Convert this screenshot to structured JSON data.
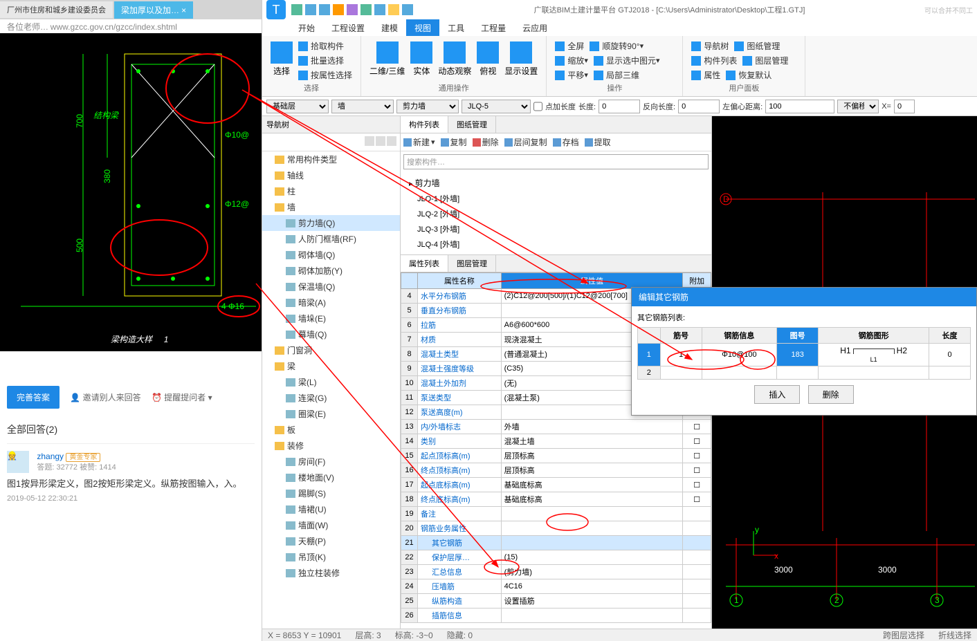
{
  "browser": {
    "tab1": "厂州市住房和城乡建设委员会",
    "tab2": "梁加厚以及加…",
    "tab2_close": "×",
    "url_prefix": "各位老师…",
    "url": "www.gzcc.gov.cn/gzcc/index.shtml"
  },
  "qa": {
    "improve_btn": "完善答案",
    "invite": "邀请别人来回答",
    "remind": "提醒提问者",
    "all_answers": "全部回答(2)",
    "user": "zhangy",
    "badge": "黄金专家",
    "stats": "答题: 32772   被赞: 1414",
    "text": "图1按异形梁定义，图2按矩形梁定义。纵筋按图输入，入。",
    "time": "2019-05-12 22:30:21"
  },
  "app": {
    "icon": "T",
    "title": "广联达BIM土建计量平台 GTJ2018 - [C:\\Users\\Administrator\\Desktop\\工程1.GTJ]",
    "merge_hint": "可以合并不同工",
    "menus": [
      "开始",
      "工程设置",
      "建模",
      "视图",
      "工具",
      "工程量",
      "云应用"
    ],
    "active_menu": 3
  },
  "ribbon": {
    "g1": {
      "label": "选择",
      "sel": "选择",
      "pick": "拾取构件",
      "batch": "批量选择",
      "filter": "按属性选择"
    },
    "g2": {
      "label": "通用操作",
      "v2d3d": "二维/三维",
      "solid": "实体",
      "dyn": "动态观察",
      "top": "俯视",
      "disp": "显示设置"
    },
    "g3": {
      "label": "操作",
      "full": "全屏",
      "rot": "顺旋转90°",
      "zoom": "缩放",
      "pan": "平移",
      "selshow": "显示选中图元",
      "local3d": "局部三维"
    },
    "g4": {
      "label": "用户面板",
      "nav": "导航树",
      "comp": "构件列表",
      "prop": "属性",
      "dwg": "图纸管理",
      "layer": "图层管理",
      "restore": "恢复默认"
    }
  },
  "cbar": {
    "floor": "基础层",
    "cat": "墙",
    "type": "剪力墙",
    "comp": "JLQ-5",
    "chk_len": "点加长度",
    "len_lbl": "长度:",
    "len": "0",
    "rev_lbl": "反向长度:",
    "rev": "0",
    "ecc_lbl": "左偏心距离:",
    "ecc": "100",
    "off": "不偏移",
    "x_lbl": "X=",
    "x": "0"
  },
  "navtree": {
    "title": "导航树",
    "common": "常用构件类型",
    "axis": "轴线",
    "col": "柱",
    "wall": "墙",
    "shear": "剪力墙(Q)",
    "civil": "人防门框墙(RF)",
    "masonry": "砌体墙(Q)",
    "infill": "砌体加筋(Y)",
    "insul": "保温墙(Q)",
    "hidden": "暗梁(A)",
    "lintel": "墙垛(E)",
    "curtain": "幕墙(Q)",
    "opening": "门窗洞",
    "beam": "梁",
    "beam_l": "梁(L)",
    "beam_g": "连梁(G)",
    "beam_e": "圈梁(E)",
    "slab": "板",
    "dec": "装修",
    "room": "房间(F)",
    "floor": "楼地面(V)",
    "skirt": "踢脚(S)",
    "wainscot": "墙裙(U)",
    "wallfin": "墙面(W)",
    "ceil": "天棚(P)",
    "susp": "吊顶(K)",
    "colfin": "独立柱装修"
  },
  "complist": {
    "tab1": "构件列表",
    "tab2": "图纸管理",
    "new": "新建",
    "copy": "复制",
    "del": "删除",
    "intercopy": "层间复制",
    "arch": "存档",
    "extract": "提取",
    "search": "搜索构件…",
    "root": "剪力墙",
    "items": [
      "JLQ-1 [外墙]",
      "JLQ-2 [外墙]",
      "JLQ-3 [外墙]",
      "JLQ-4 [外墙]"
    ]
  },
  "proplist": {
    "tab1": "属性列表",
    "tab2": "图层管理",
    "h_name": "属性名称",
    "h_val": "属性值",
    "h_add": "附加",
    "rows": [
      {
        "n": "4",
        "name": "水平分布钢筋",
        "val": "(2)C12@200[500]/(1)C12@200[700]"
      },
      {
        "n": "5",
        "name": "垂直分布钢筋",
        "val": ""
      },
      {
        "n": "6",
        "name": "拉筋",
        "val": "A6@600*600"
      },
      {
        "n": "7",
        "name": "材质",
        "val": "现浇混凝土"
      },
      {
        "n": "8",
        "name": "混凝土类型",
        "val": "(普通混凝土)"
      },
      {
        "n": "9",
        "name": "混凝土强度等级",
        "val": "(C35)"
      },
      {
        "n": "10",
        "name": "混凝土外加剂",
        "val": "(无)"
      },
      {
        "n": "11",
        "name": "泵送类型",
        "val": "(混凝土泵)"
      },
      {
        "n": "12",
        "name": "泵送高度(m)",
        "val": ""
      },
      {
        "n": "13",
        "name": "内/外墙标志",
        "val": "外墙"
      },
      {
        "n": "14",
        "name": "类别",
        "val": "混凝土墙"
      },
      {
        "n": "15",
        "name": "起点顶标高(m)",
        "val": "层顶标高"
      },
      {
        "n": "16",
        "name": "终点顶标高(m)",
        "val": "层顶标高"
      },
      {
        "n": "17",
        "name": "起点底标高(m)",
        "val": "基础底标高"
      },
      {
        "n": "18",
        "name": "终点底标高(m)",
        "val": "基础底标高"
      },
      {
        "n": "19",
        "name": "备注",
        "val": ""
      },
      {
        "n": "20",
        "name": "钢筋业务属性",
        "val": ""
      },
      {
        "n": "21",
        "name": "其它钢筋",
        "val": ""
      },
      {
        "n": "22",
        "name": "保护层厚…",
        "val": "(15)"
      },
      {
        "n": "23",
        "name": "汇总信息",
        "val": "(剪力墙)"
      },
      {
        "n": "24",
        "name": "压墙筋",
        "val": "4C16"
      },
      {
        "n": "25",
        "name": "纵筋构造",
        "val": "设置插筋"
      },
      {
        "n": "26",
        "name": "插筋信息",
        "val": ""
      }
    ]
  },
  "rebar_dlg": {
    "title": "编辑其它钢筋",
    "list_label": "其它钢筋列表:",
    "h_seq": "筋号",
    "h_info": "钢筋信息",
    "h_img": "图号",
    "h_shape": "钢筋图形",
    "h_len": "长度",
    "r1": {
      "seq": "1",
      "info": "Φ10@100",
      "img": "183",
      "h1": "H1",
      "l": "L",
      "h2": "H2",
      "len": "0",
      "l1": "L1"
    },
    "r2": "2",
    "insert": "插入",
    "delete": "删除"
  },
  "viewport": {
    "d_label": "D",
    "dim1": "3000",
    "dim2": "3000",
    "n1": "1",
    "n2": "2",
    "n3": "3"
  },
  "status": {
    "coord": "X = 8653 Y = 10901",
    "floor": "层高: 3",
    "elev": "标高: -3~0",
    "hidden": "隐藏: 0",
    "cross": "跨图层选择",
    "fold": "折线选择"
  },
  "cad": {
    "t700": "700",
    "t380": "380",
    "t500": "500",
    "label1": "结构梁",
    "d10": "Φ10@",
    "d12": "Φ12@",
    "d16": "4 Φ16",
    "title": "梁构造大样",
    "num": "1"
  }
}
